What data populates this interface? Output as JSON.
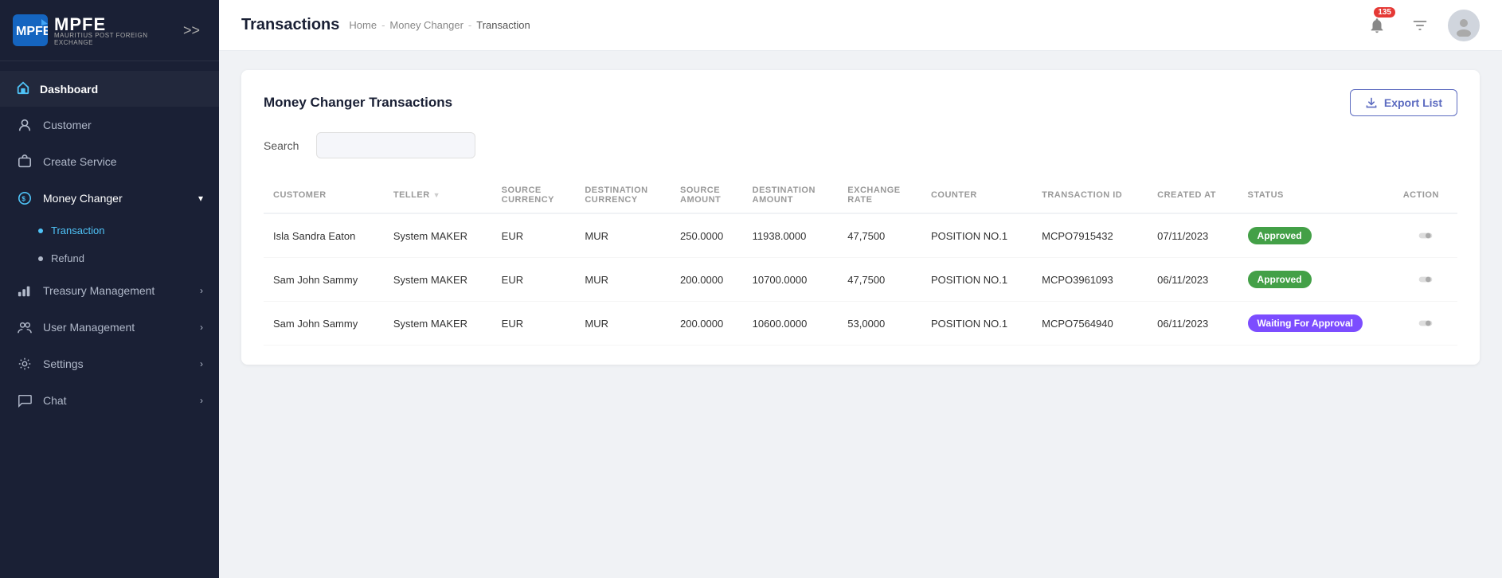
{
  "app": {
    "logo_text": "MPFE",
    "logo_sub": "MAURITIUS POST FOREIGN EXCHANGE"
  },
  "sidebar": {
    "toggle_label": ">>",
    "items": [
      {
        "id": "dashboard",
        "label": "Dashboard",
        "icon": "home-icon",
        "active": false
      },
      {
        "id": "customer",
        "label": "Customer",
        "icon": "customer-icon",
        "active": false
      },
      {
        "id": "create-service",
        "label": "Create Service",
        "icon": "create-service-icon",
        "active": false
      },
      {
        "id": "money-changer",
        "label": "Money Changer",
        "icon": "money-changer-icon",
        "active": true,
        "expanded": true,
        "chevron": "▾",
        "children": [
          {
            "id": "transaction",
            "label": "Transaction",
            "active": true
          },
          {
            "id": "refund",
            "label": "Refund",
            "active": false
          }
        ]
      },
      {
        "id": "treasury-management",
        "label": "Treasury Management",
        "icon": "treasury-icon",
        "active": false,
        "chevron": "›"
      },
      {
        "id": "user-management",
        "label": "User Management",
        "icon": "user-management-icon",
        "active": false,
        "chevron": "›"
      },
      {
        "id": "settings",
        "label": "Settings",
        "icon": "settings-icon",
        "active": false,
        "chevron": "›"
      },
      {
        "id": "chat",
        "label": "Chat",
        "icon": "chat-icon",
        "active": false,
        "chevron": "›"
      }
    ]
  },
  "header": {
    "page_title": "Transactions",
    "breadcrumb": {
      "home": "Home",
      "sep1": "-",
      "section": "Money Changer",
      "sep2": "-",
      "current": "Transaction"
    },
    "notification_count": "135"
  },
  "content": {
    "card_title": "Money Changer Transactions",
    "export_btn_label": "Export List",
    "search_label": "Search",
    "search_placeholder": "",
    "table": {
      "columns": [
        {
          "id": "customer",
          "label": "CUSTOMER"
        },
        {
          "id": "teller",
          "label": "TELLER"
        },
        {
          "id": "source_currency",
          "label": "SOURCE CURRENCY"
        },
        {
          "id": "destination_currency",
          "label": "DESTINATION CURRENCY"
        },
        {
          "id": "source_amount",
          "label": "SOURCE AMOUNT"
        },
        {
          "id": "destination_amount",
          "label": "DESTINATION AMOUNT"
        },
        {
          "id": "exchange_rate",
          "label": "EXCHANGE RATE"
        },
        {
          "id": "counter",
          "label": "COUNTER"
        },
        {
          "id": "transaction_id",
          "label": "TRANSACTION ID"
        },
        {
          "id": "created_at",
          "label": "CREATED AT"
        },
        {
          "id": "status",
          "label": "STATUS"
        },
        {
          "id": "action",
          "label": "ACTION"
        }
      ],
      "rows": [
        {
          "customer": "Isla Sandra Eaton",
          "teller": "System MAKER",
          "source_currency": "EUR",
          "destination_currency": "MUR",
          "source_amount": "250.0000",
          "destination_amount": "11938.0000",
          "exchange_rate": "47,7500",
          "counter": "POSITION NO.1",
          "transaction_id": "MCPO7915432",
          "created_at": "07/11/2023",
          "status": "Approved",
          "status_type": "approved"
        },
        {
          "customer": "Sam John Sammy",
          "teller": "System MAKER",
          "source_currency": "EUR",
          "destination_currency": "MUR",
          "source_amount": "200.0000",
          "destination_amount": "10700.0000",
          "exchange_rate": "47,7500",
          "counter": "POSITION NO.1",
          "transaction_id": "MCPO3961093",
          "created_at": "06/11/2023",
          "status": "Approved",
          "status_type": "approved"
        },
        {
          "customer": "Sam John Sammy",
          "teller": "System MAKER",
          "source_currency": "EUR",
          "destination_currency": "MUR",
          "source_amount": "200.0000",
          "destination_amount": "10600.0000",
          "exchange_rate": "53,0000",
          "counter": "POSITION NO.1",
          "transaction_id": "MCPO7564940",
          "created_at": "06/11/2023",
          "status": "Waiting For Approval",
          "status_type": "waiting"
        }
      ]
    }
  }
}
